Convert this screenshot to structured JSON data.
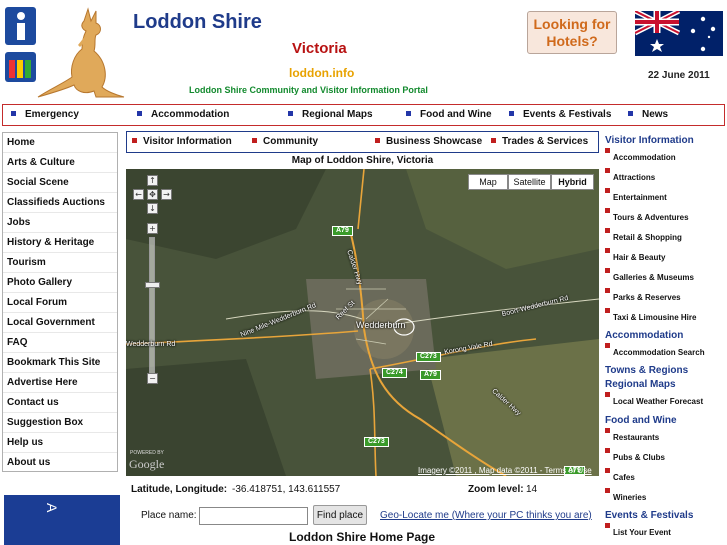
{
  "header": {
    "site_title": "Loddon Shire",
    "state": "Victoria",
    "domain": "loddon.info",
    "portal": "Loddon Shire Community and Visitor Information Portal",
    "hotels_button": "Looking for Hotels?",
    "date": "22 June 2011"
  },
  "top_nav": [
    "Emergency",
    "Accommodation",
    "Regional Maps",
    "Food and Wine",
    "Events & Festivals",
    "News"
  ],
  "left_nav": [
    "Home",
    "Arts & Culture",
    "Social Scene",
    "Classifieds Auctions",
    "Jobs",
    "History & Heritage",
    "Tourism",
    "Photo Gallery",
    "Local Forum",
    "Local Government",
    "FAQ",
    "Bookmark This Site",
    "Advertise Here",
    "Contact us",
    "Suggestion Box",
    "Help us",
    "About us"
  ],
  "sub_nav": [
    "Visitor Information",
    "Community",
    "Business Showcase",
    "Trades & Services"
  ],
  "map": {
    "title": "Map of Loddon Shire, Victoria",
    "types": [
      "Map",
      "Satellite",
      "Hybrid"
    ],
    "active_type": "Hybrid",
    "town": "Wedderburn",
    "roads": [
      "Nine Mile-Wedderburn Rd",
      "Reef St",
      "Calder Hwy",
      "Boort-Wedderburn Rd",
      "Korong Vale Rd",
      "Wedderburn Rd",
      "Calder Hwy"
    ],
    "shields": [
      "A79",
      "C273",
      "C274",
      "A79",
      "C273",
      "A79"
    ],
    "powered_by": "POWERED BY",
    "logo": "Google",
    "attribution": "Imagery ©2011 , Map data ©2011 - Terms of Use"
  },
  "coords": {
    "latlng_label": "Latitude, Longitude:",
    "latlng_value": "-36.418751, 143.611557",
    "zoom_label": "Zoom level:",
    "zoom_value": "14"
  },
  "search": {
    "place_label": "Place name:",
    "place_value": "",
    "find_button": "Find place",
    "geo_link": "Geo-Locate me (Where your PC thinks you are)"
  },
  "home_heading": "Loddon Shire Home Page",
  "right_sidebar": {
    "visitor_head": "Visitor Information",
    "visitor_items": [
      "Accommodation",
      "Attractions",
      "Entertainment",
      "Tours & Adventures",
      "Retail & Shopping",
      "Hair & Beauty",
      "Galleries & Museums",
      "Parks & Reserves",
      "Taxi & Limousine Hire"
    ],
    "accommodation_head": "Accommodation",
    "accommodation_items": [
      "Accommodation Search"
    ],
    "towns_head": "Towns & Regions",
    "maps_head": "Regional Maps",
    "maps_items": [
      "Local Weather Forecast"
    ],
    "food_head": "Food and Wine",
    "food_items": [
      "Restaurants",
      "Pubs & Clubs",
      "Cafes",
      "Wineries"
    ],
    "events_head": "Events & Festivals",
    "events_items": [
      "List Your Event"
    ]
  },
  "colors": {
    "brand_blue": "#1f3b8a",
    "accent_red": "#b81212",
    "domain_orange": "#e8a200",
    "portal_green": "#138a2e"
  }
}
